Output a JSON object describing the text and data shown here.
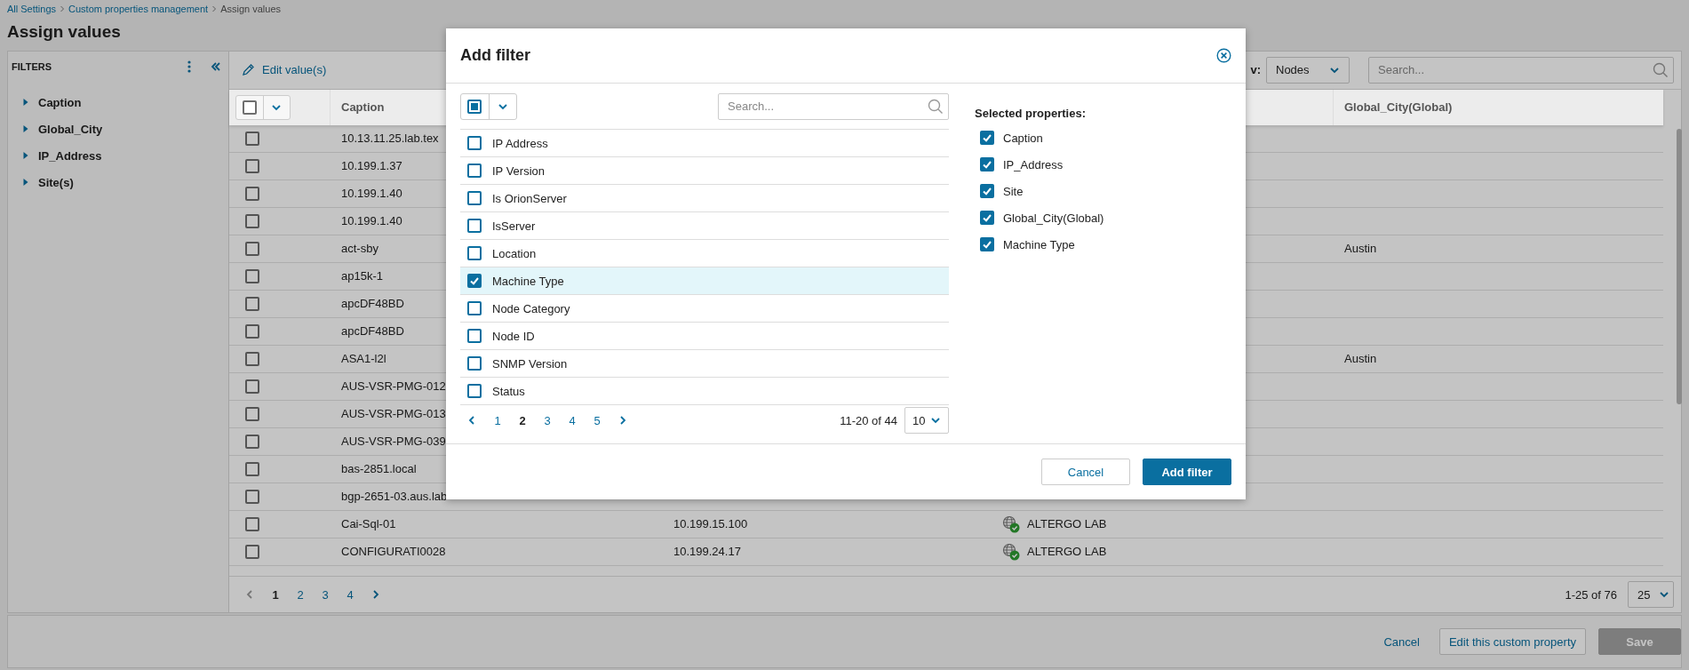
{
  "breadcrumb": [
    {
      "label": "All Settings"
    },
    {
      "label": "Custom properties management"
    },
    {
      "label": "Assign values"
    }
  ],
  "title": "Assign values",
  "filters": {
    "title": "FILTERS",
    "items": [
      {
        "label": "Caption",
        "expanded": false
      },
      {
        "label": "Global_City",
        "expanded": false
      },
      {
        "label": "IP_Address",
        "expanded": false
      },
      {
        "label": "Site(s)",
        "expanded": false
      }
    ]
  },
  "toolbar": {
    "edit_label": "Edit value(s)",
    "view_label": "v:",
    "view_value": "Nodes",
    "search": {
      "placeholder": "Search..."
    }
  },
  "table": {
    "select_all": {
      "checked": false
    },
    "column_headers": {
      "caption": "Caption",
      "global_city": "Global_City(Global)"
    },
    "rows": [
      {
        "caption": "10.13.11.25.lab.tex",
        "checked": false
      },
      {
        "caption": "10.199.1.37",
        "checked": false
      },
      {
        "caption": "10.199.1.40",
        "checked": false
      },
      {
        "caption": "10.199.1.40",
        "checked": false
      },
      {
        "caption": "act-sby",
        "global_city": "Austin",
        "checked": false
      },
      {
        "caption": "ap15k-1",
        "checked": false
      },
      {
        "caption": "apcDF48BD",
        "checked": false
      },
      {
        "caption": "apcDF48BD",
        "checked": false
      },
      {
        "caption": "ASA1-l2l",
        "global_city": "Austin",
        "checked": false
      },
      {
        "caption": "AUS-VSR-PMG-012",
        "checked": false
      },
      {
        "caption": "AUS-VSR-PMG-013",
        "checked": false
      },
      {
        "caption": "AUS-VSR-PMG-039",
        "checked": false
      },
      {
        "caption": "bas-2851.local",
        "checked": false
      },
      {
        "caption": "bgp-2651-03.aus.lab",
        "checked": false
      },
      {
        "caption": "Cai-Sql-01",
        "column_3": "10.199.15.100",
        "column_4": "ALTERGO LAB",
        "checked": false
      },
      {
        "caption": "CONFIGURATI0028",
        "column_3": "10.199.24.17",
        "column_4": "ALTERGO LAB",
        "checked": false
      }
    ]
  },
  "pagination": {
    "pages": [
      {
        "label": "1",
        "selected": true
      },
      {
        "label": "2",
        "selected": false
      },
      {
        "label": "3",
        "selected": false
      },
      {
        "label": "4",
        "selected": false
      }
    ],
    "range": "1-25 of 76",
    "page_size": "25"
  },
  "footer": {
    "cancel": "Cancel",
    "edit_property": "Edit this custom property",
    "save": {
      "label": "Save",
      "disabled": true
    }
  },
  "modal": {
    "title": "Add filter",
    "select_all": {
      "partial": true
    },
    "search": {
      "placeholder": "Search..."
    },
    "properties": [
      {
        "label": "IP Address",
        "checked": false
      },
      {
        "label": "IP Version",
        "checked": false
      },
      {
        "label": "Is OrionServer",
        "checked": false
      },
      {
        "label": "IsServer",
        "checked": false
      },
      {
        "label": "Location",
        "checked": false
      },
      {
        "label": "Machine Type",
        "checked": true
      },
      {
        "label": "Node Category",
        "checked": false
      },
      {
        "label": "Node ID",
        "checked": false
      },
      {
        "label": "SNMP Version",
        "checked": false
      },
      {
        "label": "Status",
        "checked": false
      }
    ],
    "pagination": {
      "pages": [
        {
          "label": "1",
          "selected": false
        },
        {
          "label": "2",
          "selected": true
        },
        {
          "label": "3",
          "selected": false
        },
        {
          "label": "4",
          "selected": false
        },
        {
          "label": "5",
          "selected": false
        }
      ],
      "range": "11-20 of 44",
      "page_size": "10"
    },
    "selected_title": "Selected properties:",
    "selected": [
      {
        "label": "Caption",
        "checked": true
      },
      {
        "label": "IP_Address",
        "checked": true
      },
      {
        "label": "Site",
        "checked": true
      },
      {
        "label": "Global_City(Global)",
        "checked": true
      },
      {
        "label": "Machine Type",
        "checked": true
      }
    ],
    "buttons": {
      "cancel": "Cancel",
      "add": "Add filter"
    }
  }
}
